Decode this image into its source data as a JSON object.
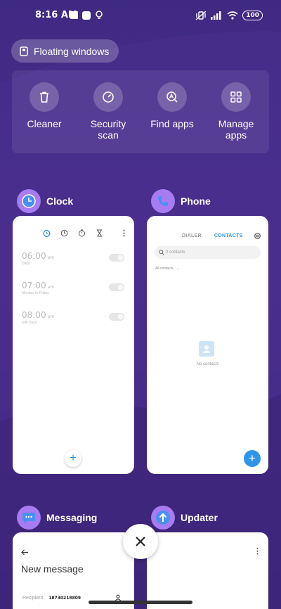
{
  "status_bar": {
    "time": "8:16 AM",
    "battery": "100"
  },
  "floating_windows": {
    "label": "Floating windows"
  },
  "quick_actions": [
    {
      "label": "Cleaner",
      "icon": "trash-icon"
    },
    {
      "label": "Security\nscan",
      "icon": "gauge-icon"
    },
    {
      "label": "Find apps",
      "icon": "search-apps-icon"
    },
    {
      "label": "Manage\napps",
      "icon": "grid-icon"
    }
  ],
  "apps": {
    "clock": {
      "name": "Clock",
      "alarms": [
        {
          "time": "06:00",
          "ampm": "am",
          "sub": "Daily"
        },
        {
          "time": "07:00",
          "ampm": "am",
          "sub": "Monday to Friday"
        },
        {
          "time": "08:00",
          "ampm": "am",
          "sub": "Edit Days"
        }
      ],
      "add_label": "+"
    },
    "phone": {
      "name": "Phone",
      "tab_dialer": "DIALER",
      "tab_contacts": "CONTACTS",
      "search_placeholder": "0 contacts",
      "all_contacts": "All contacts",
      "empty_text": "No contacts",
      "fab_label": "+"
    },
    "messaging": {
      "name": "Messaging",
      "title": "New message",
      "recipient_label": "Recipient",
      "recipient_value": "18730218809"
    },
    "updater": {
      "name": "Updater"
    }
  },
  "colors": {
    "accent_blue": "#2e95e8",
    "background": "#3f2a82",
    "app_icon": "#a77cf0"
  }
}
